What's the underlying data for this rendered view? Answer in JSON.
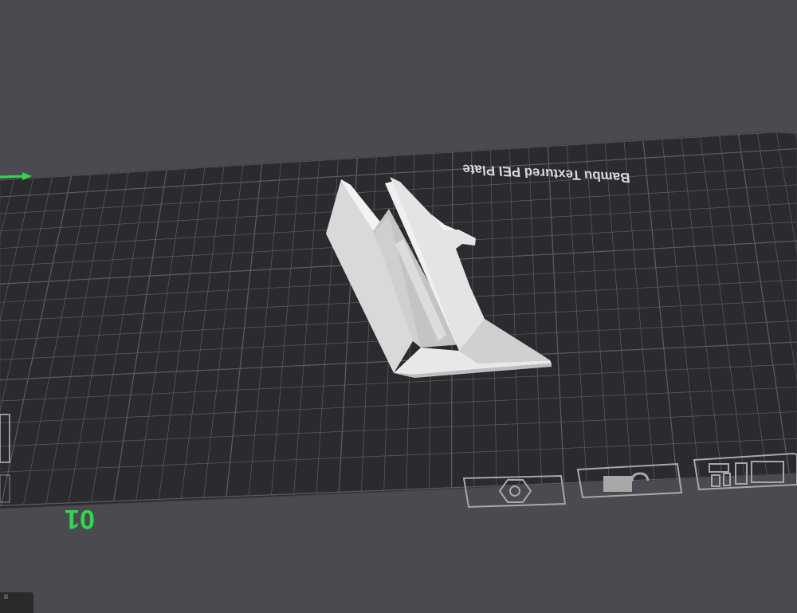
{
  "viewport": {
    "background_color": "#4a4a50",
    "plate_color": "#2b2b2f",
    "grid_color": "#5c5c62",
    "plate_label": "Bambu Textured PEI Plate",
    "plate_number": "01",
    "accent_color": "#2fd84d",
    "model_color": "#e6e6e6"
  },
  "axis": {
    "x_axis_name": "x-axis-arrow",
    "color": "#2fd84d"
  },
  "plate_buttons": [
    {
      "name": "auto-orient-button",
      "icon": "nut-icon"
    },
    {
      "name": "lock-plate-button",
      "icon": "unlock-icon"
    },
    {
      "name": "arrange-button",
      "icon": "layout-icon"
    }
  ],
  "corner_widget": {
    "label": "⌘"
  }
}
